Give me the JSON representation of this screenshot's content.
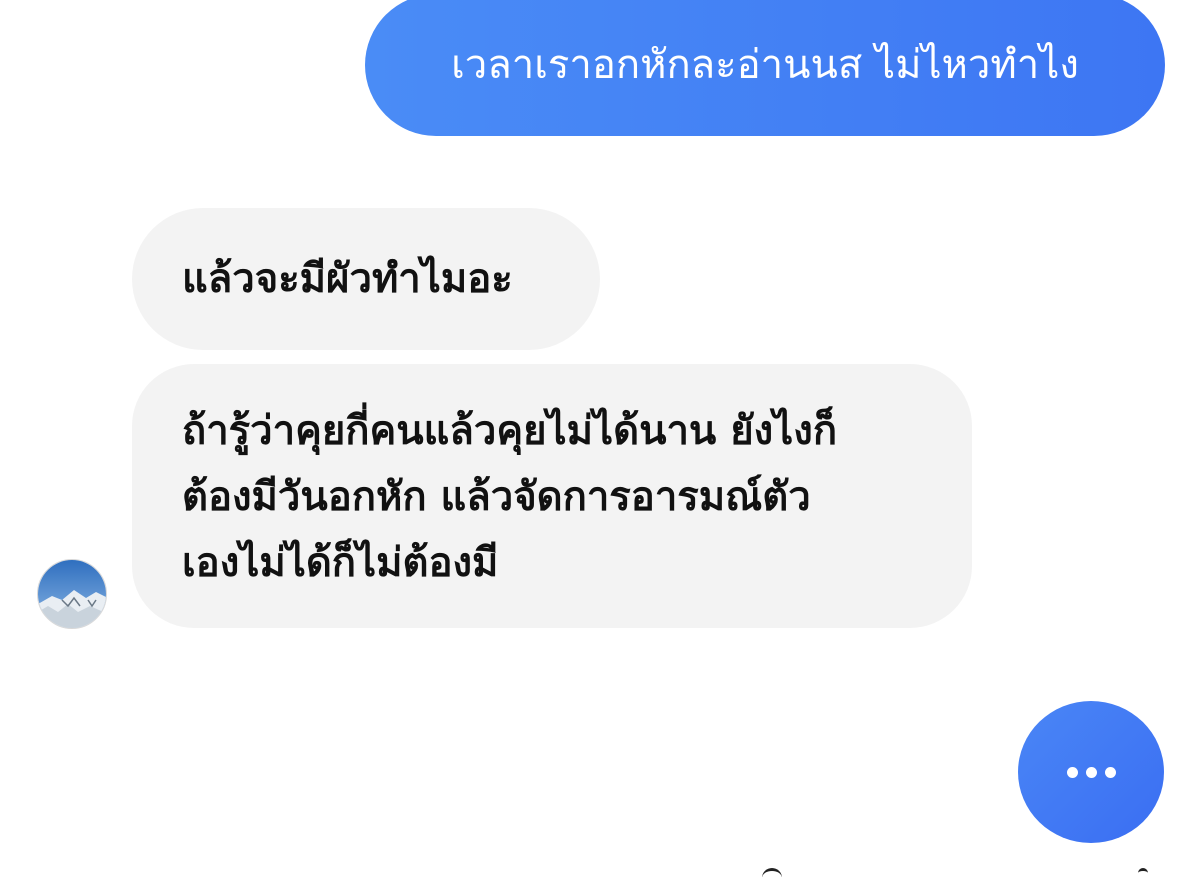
{
  "messages": {
    "outgoing": [
      {
        "text": "เวลาเราอกหักละอ่านนส ไม่ไหวทำไง"
      }
    ],
    "incoming": [
      {
        "lines": [
          "แล้วจะมีผัวทำไมอะ"
        ]
      },
      {
        "lines": [
          "ถ้ารู้ว่าคุยกี่คนแล้วคุยไม่ได้นาน ยังไงก็",
          "ต้องมีวันอกหัก แล้วจัดการอารมณ์ตัว",
          "เองไม่ได้ก็ไม่ต้องมี"
        ]
      }
    ]
  },
  "typing_indicator": {
    "label": "..."
  },
  "colors": {
    "outgoing_bubble": "#4a8cf6",
    "incoming_bubble": "#f3f3f3",
    "background": "#ffffff"
  },
  "icons": {
    "avatar": "mountain-snow-avatar-icon",
    "typing": "ellipsis-icon"
  }
}
